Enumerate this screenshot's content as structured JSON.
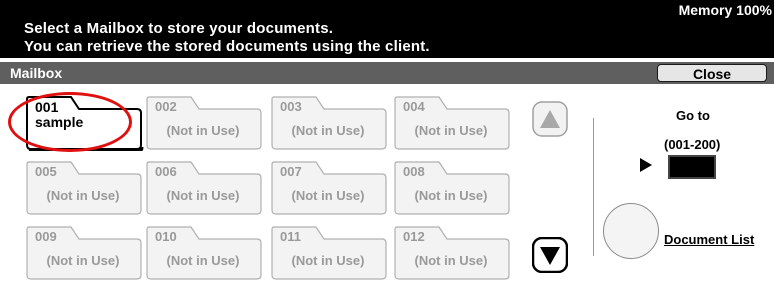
{
  "header": {
    "message_line1": "Select a Mailbox to store your documents.",
    "message_line2": "You can retrieve the stored documents using the client.",
    "memory": "Memory 100%"
  },
  "mailbox_bar": {
    "title": "Mailbox",
    "close_label": "Close"
  },
  "mailboxes": [
    {
      "number": "001",
      "name": "sample",
      "in_use": true
    },
    {
      "number": "002",
      "name": "(Not in Use)",
      "in_use": false
    },
    {
      "number": "003",
      "name": "(Not in Use)",
      "in_use": false
    },
    {
      "number": "004",
      "name": "(Not in Use)",
      "in_use": false
    },
    {
      "number": "005",
      "name": "(Not in Use)",
      "in_use": false
    },
    {
      "number": "006",
      "name": "(Not in Use)",
      "in_use": false
    },
    {
      "number": "007",
      "name": "(Not in Use)",
      "in_use": false
    },
    {
      "number": "008",
      "name": "(Not in Use)",
      "in_use": false
    },
    {
      "number": "009",
      "name": "(Not in Use)",
      "in_use": false
    },
    {
      "number": "010",
      "name": "(Not in Use)",
      "in_use": false
    },
    {
      "number": "011",
      "name": "(Not in Use)",
      "in_use": false
    },
    {
      "number": "012",
      "name": "(Not in Use)",
      "in_use": false
    }
  ],
  "scroll": {
    "up_icon": "triangle-up-icon",
    "down_icon": "triangle-down-icon"
  },
  "goto": {
    "label": "Go to",
    "range": "(001-200)",
    "arrow_icon": "play-arrow-icon",
    "value": ""
  },
  "document_list": {
    "label": "Document List"
  },
  "colors": {
    "header_bg": "#000000",
    "bar_bg": "#5f5f5f",
    "disabled_text": "#9a9a9a",
    "highlight": "#e01010"
  }
}
